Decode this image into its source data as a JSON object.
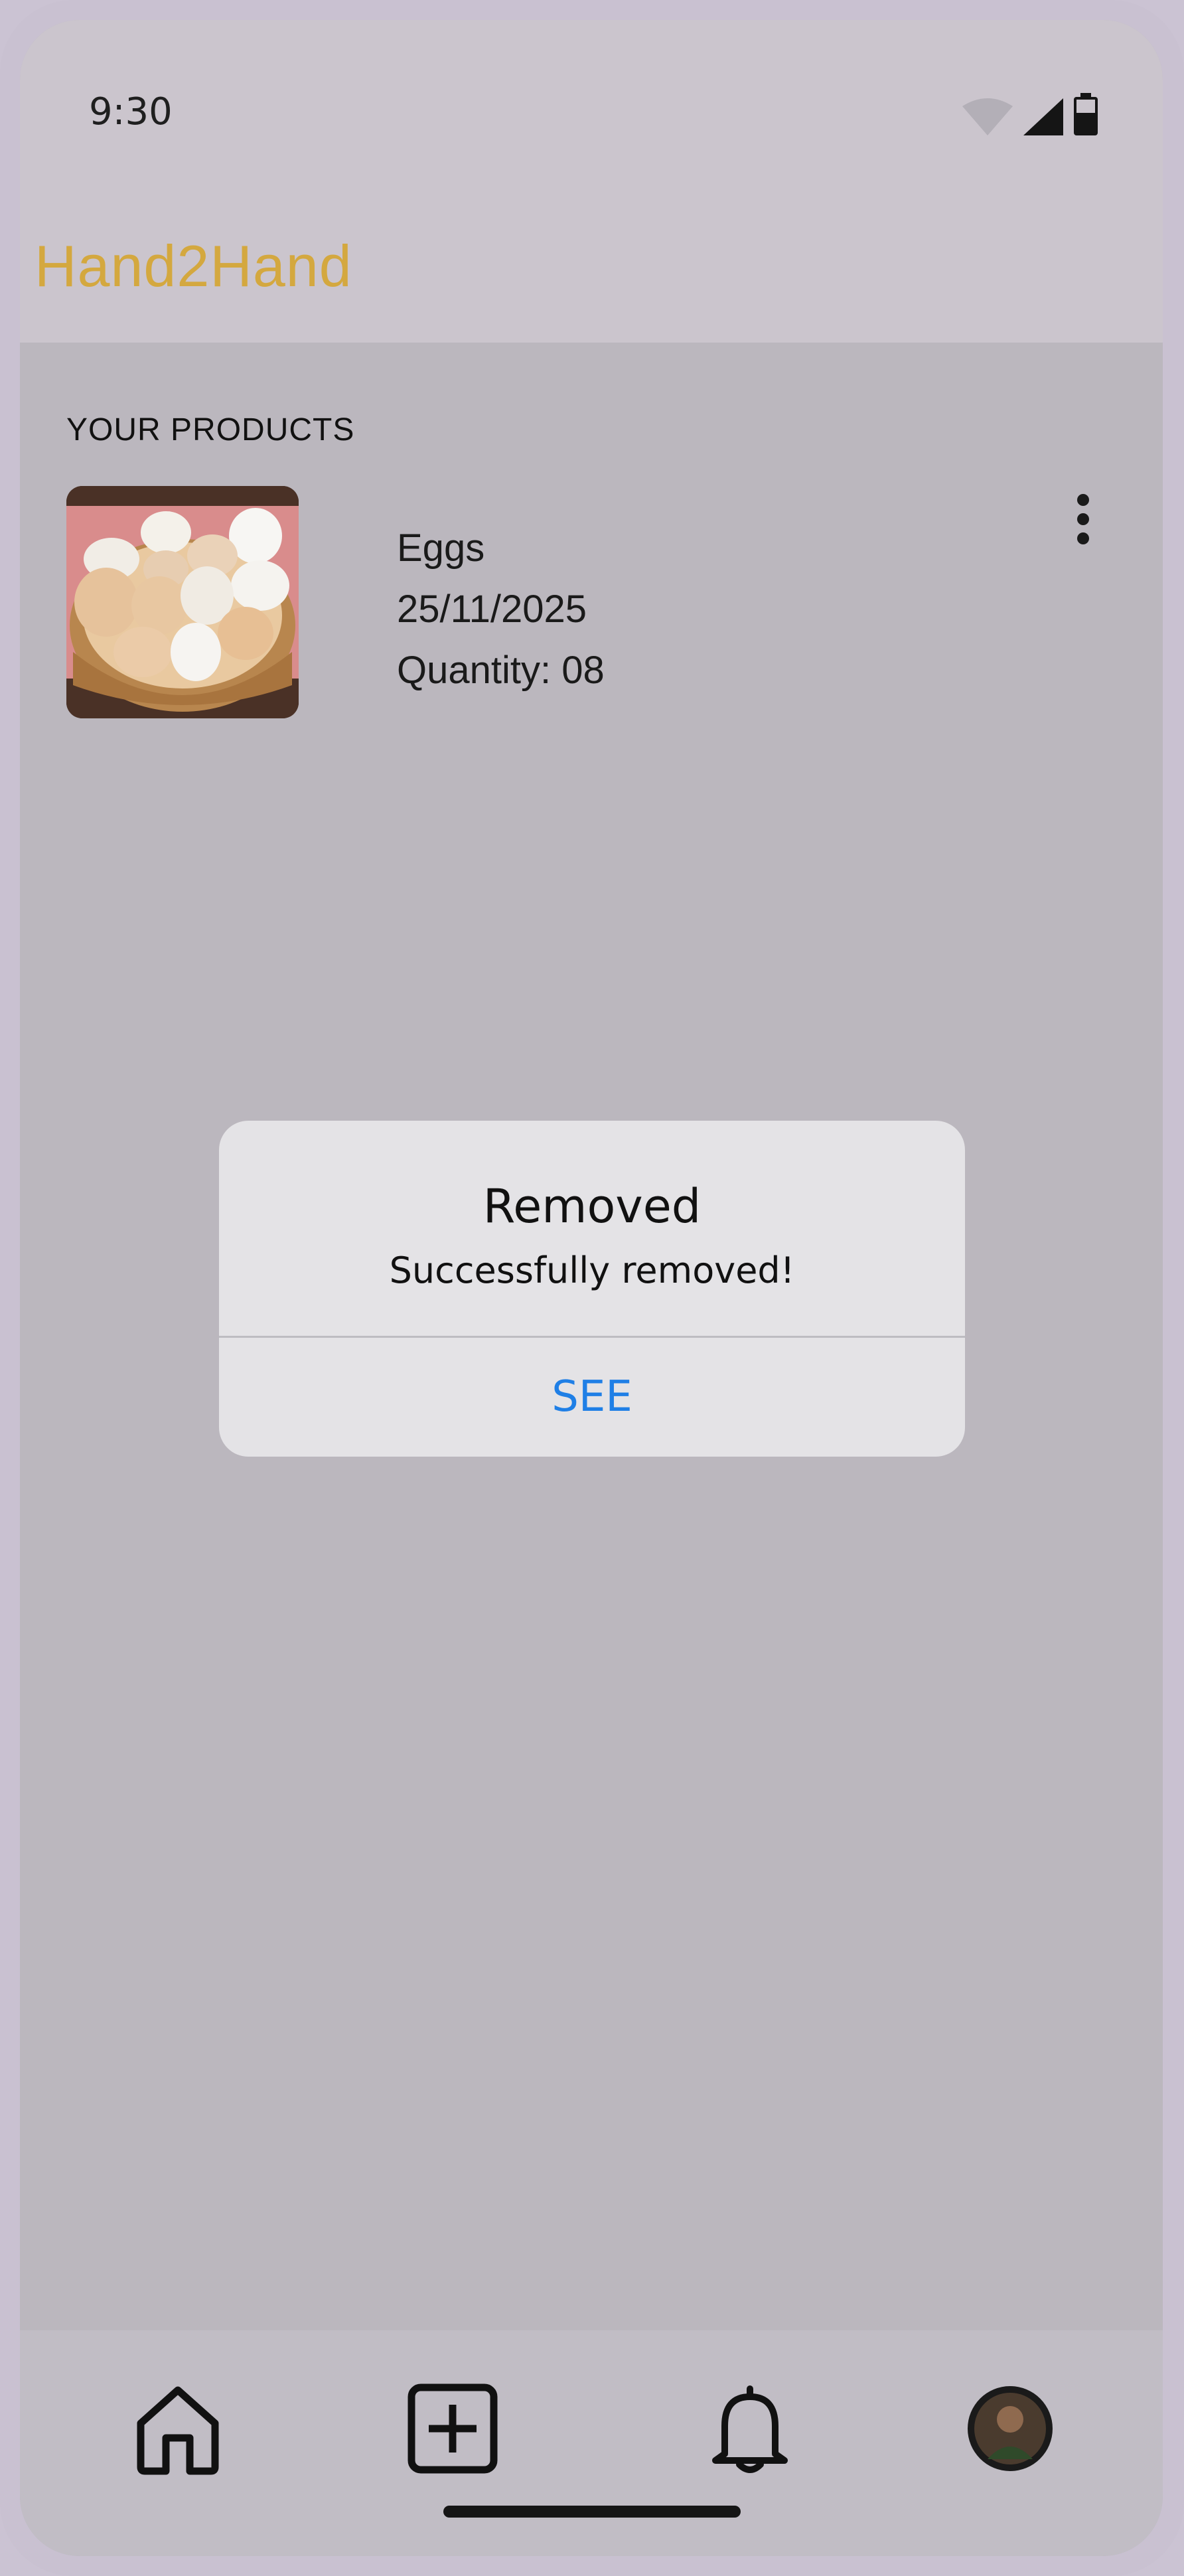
{
  "status_bar": {
    "time": "9:30"
  },
  "app": {
    "title": "Hand2Hand",
    "title_color": "#d4a83f"
  },
  "section": {
    "title": "YOUR PRODUCTS"
  },
  "product": {
    "name": "Eggs",
    "date": "25/11/2025",
    "quantity": "Quantity: 08"
  },
  "dialog": {
    "title": "Removed",
    "message": "Successfully removed!",
    "button_label": "SEE",
    "button_color": "#1f7fe6"
  },
  "bottom_nav": [
    {
      "icon": "home-icon"
    },
    {
      "icon": "add-box-icon"
    },
    {
      "icon": "bell-icon"
    },
    {
      "icon": "profile-avatar"
    }
  ]
}
